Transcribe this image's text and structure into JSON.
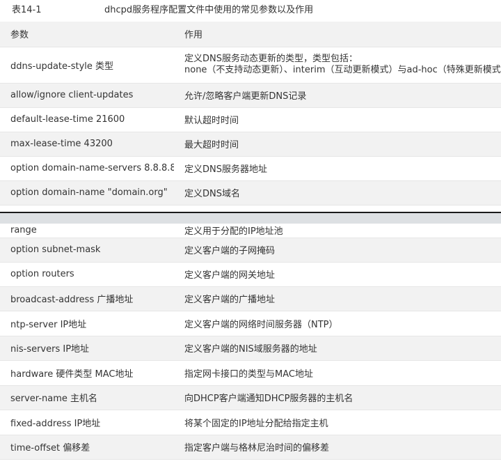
{
  "caption": {
    "number": "表14-1",
    "title": "dhcpd服务程序配置文件中使用的常见参数以及作用"
  },
  "header": {
    "param": "参数",
    "purpose": "作用"
  },
  "rows_top": [
    {
      "param": "ddns-update-style 类型",
      "purpose": "定义DNS服务动态更新的类型，类型包括：",
      "purpose2": "none（不支持动态更新）、interim（互动更新模式）与ad-hoc（特殊更新模式）"
    },
    {
      "param": "allow/ignore client-updates",
      "purpose": "允许/忽略客户端更新DNS记录"
    },
    {
      "param": "default-lease-time 21600",
      "purpose": "默认超时时间"
    },
    {
      "param": "max-lease-time 43200",
      "purpose": "最大超时时间"
    },
    {
      "param": "option domain-name-servers 8.8.8.8",
      "purpose": "定义DNS服务器地址"
    },
    {
      "param": "option domain-name \"domain.org\"",
      "purpose": "定义DNS域名"
    }
  ],
  "rows_bottom": [
    {
      "param": "range",
      "purpose": "定义用于分配的IP地址池"
    },
    {
      "param": "option subnet-mask",
      "purpose": "定义客户端的子网掩码"
    },
    {
      "param": "option routers",
      "purpose": "定义客户端的网关地址"
    },
    {
      "param": "broadcast-address 广播地址",
      "purpose": "定义客户端的广播地址"
    },
    {
      "param": "ntp-server IP地址",
      "purpose": "定义客户端的网络时间服务器（NTP）"
    },
    {
      "param": "nis-servers IP地址",
      "purpose": "定义客户端的NIS域服务器的地址"
    },
    {
      "param": "hardware 硬件类型 MAC地址",
      "purpose": "指定网卡接口的类型与MAC地址"
    },
    {
      "param": "server-name 主机名",
      "purpose": "向DHCP客户端通知DHCP服务器的主机名"
    },
    {
      "param": "fixed-address IP地址",
      "purpose": "将某个固定的IP地址分配给指定主机"
    },
    {
      "param": "time-offset 偏移差",
      "purpose": "指定客户端与格林尼治时间的偏移差"
    }
  ]
}
